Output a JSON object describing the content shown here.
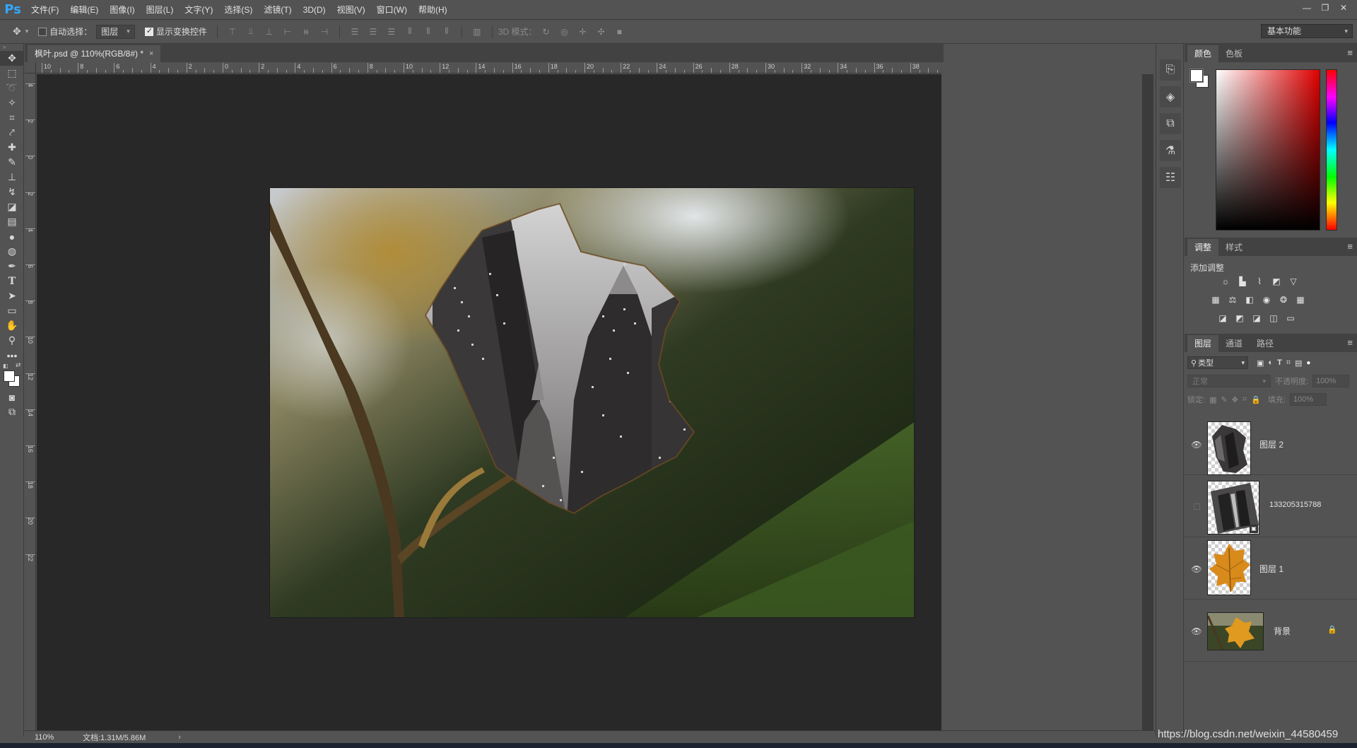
{
  "app": {
    "logo": "Ps"
  },
  "menu": [
    "文件(F)",
    "编辑(E)",
    "图像(I)",
    "图层(L)",
    "文字(Y)",
    "选择(S)",
    "滤镜(T)",
    "3D(D)",
    "视图(V)",
    "窗口(W)",
    "帮助(H)"
  ],
  "window_controls": [
    "—",
    "❐",
    "✕"
  ],
  "options": {
    "auto_select_label": "自动选择：",
    "auto_select_checked": false,
    "auto_select_target": "图层",
    "show_transform_label": "显示变换控件",
    "show_transform_checked": true,
    "mode_3d_label": "3D 模式：",
    "workspace": "基本功能"
  },
  "document": {
    "tab_title": "枫叶.psd @ 110%(RGB/8#) *",
    "zoom": "110%",
    "doc_info": "文档:1.31M/5.86M"
  },
  "rulers": {
    "top": [
      "10",
      "8",
      "6",
      "4",
      "2",
      "0",
      "2",
      "4",
      "6",
      "8",
      "10",
      "12",
      "14",
      "16",
      "18",
      "20",
      "22",
      "24",
      "26",
      "28",
      "30",
      "32",
      "34",
      "36",
      "38"
    ],
    "left": [
      "4",
      "2",
      "0",
      "2",
      "4",
      "6",
      "8",
      "10",
      "12",
      "14",
      "16",
      "18",
      "20",
      "22"
    ]
  },
  "panels": {
    "color_tabs": [
      "颜色",
      "色板"
    ],
    "adjust_tabs": [
      "调整",
      "样式"
    ],
    "adjust_label": "添加调整",
    "layers_tabs": [
      "图层",
      "通道",
      "路径"
    ],
    "filter_kind": "类型",
    "blend_mode": "正常",
    "opacity_label": "不透明度:",
    "opacity_value": "100%",
    "lock_label": "锁定:",
    "fill_label": "填充:",
    "fill_value": "100%",
    "colors": {
      "foreground": "#ffffff",
      "background": "#ffffff",
      "accent": "#31a8ff"
    }
  },
  "layers": [
    {
      "name": "图层 2",
      "visible": true,
      "thumb": "city-leaf"
    },
    {
      "name": "133205315788",
      "visible": false,
      "thumb": "city-photo",
      "smart_object": true
    },
    {
      "name": "图层 1",
      "visible": true,
      "thumb": "leaf"
    },
    {
      "name": "背景",
      "visible": true,
      "thumb": "background",
      "locked": true
    }
  ],
  "watermark": "https://blog.csdn.net/weixin_44580459"
}
